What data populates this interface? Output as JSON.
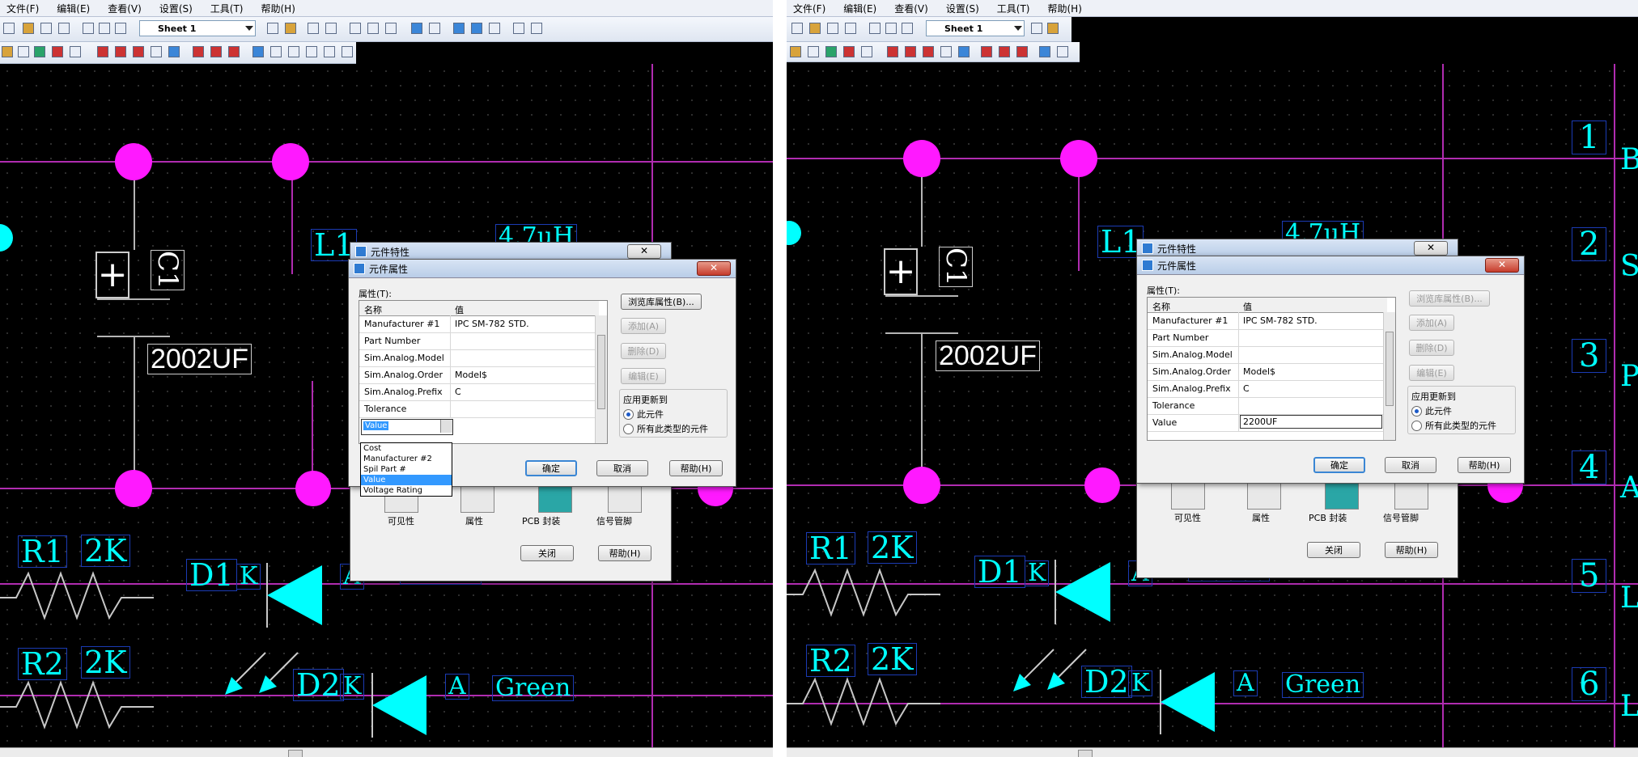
{
  "menu": {
    "items": [
      "文件(F)",
      "编辑(E)",
      "查看(V)",
      "设置(S)",
      "工具(T)",
      "帮助(H)"
    ]
  },
  "toolbar": {
    "sheet_select": "Sheet 1"
  },
  "schematic": {
    "cap_ref": "C1",
    "cap_value": "2002UF",
    "ind_ref": "L1",
    "ind_value": "4.7uH",
    "r1_ref": "R1",
    "r1_value": "2K",
    "r2_ref": "R2",
    "r2_value": "2K",
    "d1_ref": "D1",
    "d2_ref": "D2",
    "pin_k": "K",
    "pin_a": "A",
    "led_color": "Green",
    "connector_numbers": [
      "1",
      "2",
      "3",
      "4",
      "5",
      "6"
    ],
    "connector_letters": [
      "B",
      "S",
      "P",
      "A",
      "L",
      "L"
    ]
  },
  "back_dialog": {
    "title": "元件特性",
    "close": "✕",
    "icons": [
      "可见性",
      "属性",
      "PCB 封装",
      "信号管脚"
    ],
    "close_button": "关闭",
    "help_button": "帮助(H)"
  },
  "front_dialog": {
    "title": "元件属性",
    "close": "✕",
    "props_label": "属性(T):",
    "col_name": "名称",
    "col_value": "值",
    "rows": [
      {
        "name": "Manufacturer #1",
        "value": "IPC SM-782 STD."
      },
      {
        "name": "Part Number",
        "value": ""
      },
      {
        "name": "Sim.Analog.Model",
        "value": ""
      },
      {
        "name": "Sim.Analog.Order",
        "value": "Model$"
      },
      {
        "name": "Sim.Analog.Prefix",
        "value": "C"
      },
      {
        "name": "Tolerance",
        "value": ""
      }
    ],
    "left_last_field": "Value",
    "right_last_name": "Value",
    "right_last_value": "2200UF",
    "dropdown_options": [
      "Cost",
      "Manufacturer #2",
      "Spil Part #",
      "Value",
      "Voltage Rating"
    ],
    "dropdown_selected": "Value",
    "btn_browse": "浏览库属性(B)...",
    "btn_add": "添加(A)",
    "btn_delete": "删除(D)",
    "btn_edit": "编辑(E)",
    "apply_label": "应用更新到",
    "radio_this": "此元件",
    "radio_all": "所有此类型的元件",
    "btn_ok": "确定",
    "btn_cancel": "取消",
    "btn_help": "帮助(H)"
  }
}
